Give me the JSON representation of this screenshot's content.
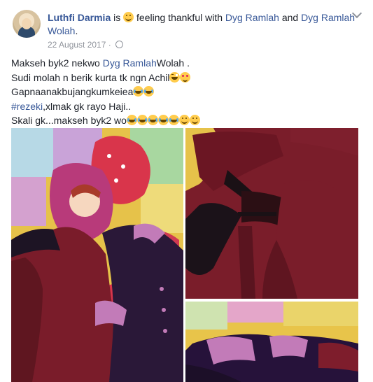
{
  "post": {
    "author": "Luthfi Darmia",
    "is_word": "is",
    "feeling_text": "feeling thankful with",
    "tag1": "Dyg Ramlah",
    "and_word": "and",
    "tag2": "Dyg Ramlah Wolah",
    "period": ".",
    "date": "22 August 2017",
    "sep": "·"
  },
  "body": {
    "line1_a": "Makseh byk2 nekwo",
    "line1_link": "Dyg Ramlah",
    "line1_b": "Wolah .",
    "line2": "Sudi molah n berik kurta tk ngn Achil",
    "line3": "Gapnaanakbujangkumkeiea",
    "line4_link": "#rezeki",
    "line4_b": ",xlmak gk rayo Haji..",
    "line5": "Skali gk...makseh byk2 wo"
  },
  "icons": {
    "globe": "globe-icon",
    "chevron": "chevron-down-icon",
    "emoji_feeling": "smiling-face-icon"
  },
  "colors": {
    "link": "#385898",
    "text": "#1d2129",
    "meta": "#90949c"
  }
}
